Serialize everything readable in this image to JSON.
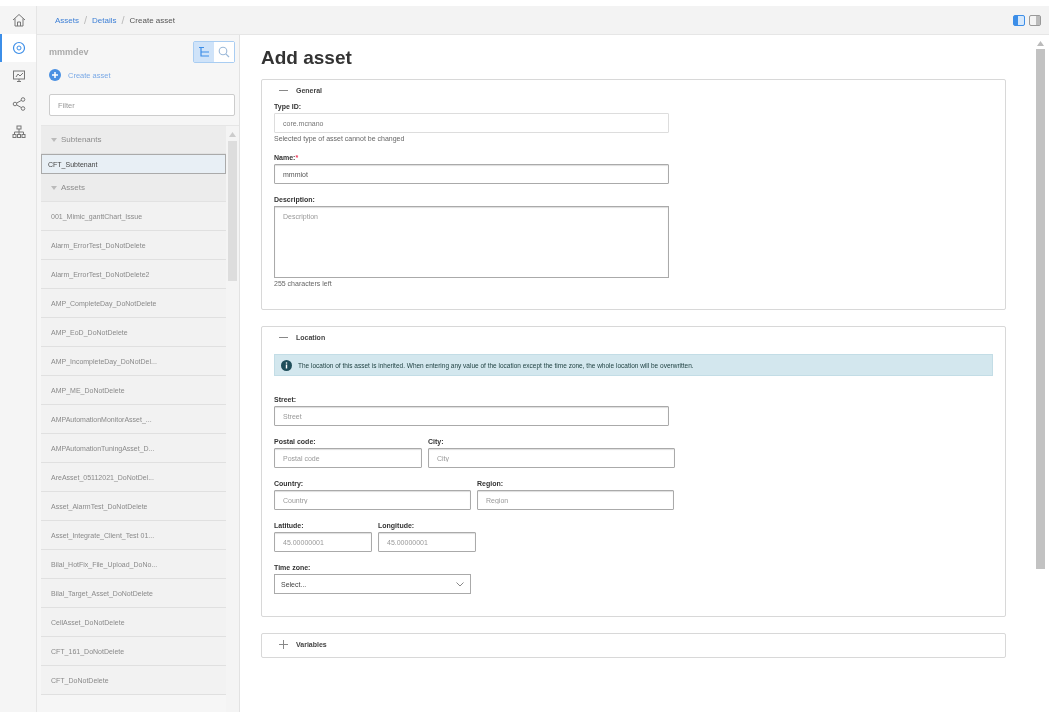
{
  "breadcrumbs": [
    {
      "label": "Assets",
      "kind": "link"
    },
    {
      "separator": "/",
      "label": "Details",
      "kind": "link"
    },
    {
      "separator": "/",
      "label": "Create asset",
      "kind": "current"
    }
  ],
  "view_toggles": [
    {
      "kind": "left-pane",
      "selected": true
    },
    {
      "kind": "right-pane",
      "selected": false
    }
  ],
  "rail": [
    {
      "kind": "home",
      "selected": false
    },
    {
      "kind": "assets",
      "selected": true
    },
    {
      "kind": "monitor",
      "selected": false
    },
    {
      "kind": "share",
      "selected": false
    },
    {
      "kind": "hierarchy",
      "selected": false
    }
  ],
  "sidebar": {
    "tenant": "mmmdev",
    "modes": [
      {
        "kind": "tree",
        "selected": true
      },
      {
        "kind": "search",
        "selected": false
      }
    ],
    "create_label": "Create asset",
    "filter_placeholder": "Filter",
    "tree": [
      {
        "label": "Subtenants",
        "expanded": true,
        "children": [
          {
            "label": "CFT_Subtenant",
            "selected": true
          }
        ]
      },
      {
        "label": "Assets",
        "expanded": true,
        "children": [
          {
            "label": "001_Mimic_ganttChart_Issue",
            "selected": false
          },
          {
            "label": "Alarm_ErrorTest_DoNotDelete",
            "selected": false
          },
          {
            "label": "Alarm_ErrorTest_DoNotDelete2",
            "selected": false
          },
          {
            "label": "AMP_CompleteDay_DoNotDelete",
            "selected": false
          },
          {
            "label": "AMP_EoD_DoNotDelete",
            "selected": false
          },
          {
            "label": "AMP_IncompleteDay_DoNotDel...",
            "selected": false
          },
          {
            "label": "AMP_ME_DoNotDelete",
            "selected": false
          },
          {
            "label": "AMPAutomationMonitorAsset_...",
            "selected": false
          },
          {
            "label": "AMPAutomationTuningAsset_D...",
            "selected": false
          },
          {
            "label": "AreAsset_05112021_DoNotDel...",
            "selected": false
          },
          {
            "label": "Asset_AlarmTest_DoNotDelete",
            "selected": false
          },
          {
            "label": "Asset_Integrate_Client_Test 01...",
            "selected": false
          },
          {
            "label": "Bilal_HotFix_File_Upload_DoNo...",
            "selected": false
          },
          {
            "label": "Bilal_Target_Asset_DoNotDelete",
            "selected": false
          },
          {
            "label": "CellAsset_DoNotDelete",
            "selected": false
          },
          {
            "label": "CFT_161_DoNotDelete",
            "selected": false
          },
          {
            "label": "CFT_DoNotDelete",
            "selected": false
          }
        ]
      }
    ]
  },
  "page_title": "Add asset",
  "sections": [
    {
      "title": "General",
      "expanded": true,
      "rows": [
        [
          {
            "label": "Type ID:",
            "kind": "text",
            "value": "core.mcnano",
            "readonly": true,
            "hint": "Selected type of asset cannot be changed"
          }
        ],
        [
          {
            "label": "Name:",
            "kind": "text",
            "value": "mmmiot",
            "required_mark": "*"
          }
        ],
        [
          {
            "label": "Description:",
            "kind": "textarea",
            "placeholder": "Description",
            "hint": "255 characters left"
          }
        ]
      ]
    },
    {
      "title": "Location",
      "expanded": true,
      "notice": "The location of this asset is inherited. When entering any value of the location except the time zone, the whole location will be overwritten.",
      "rows": [
        [
          {
            "label": "Street:",
            "kind": "text",
            "placeholder": "Street"
          }
        ],
        [
          {
            "label": "Postal code:",
            "kind": "text",
            "placeholder": "Postal code"
          },
          {
            "label": "City:",
            "kind": "text",
            "placeholder": "City"
          }
        ],
        [
          {
            "label": "Country:",
            "kind": "text",
            "placeholder": "Country"
          },
          {
            "label": "Region:",
            "kind": "text",
            "placeholder": "Region"
          }
        ],
        [
          {
            "label": "Latitude:",
            "kind": "text",
            "placeholder": "45.00000001"
          },
          {
            "label": "Longitude:",
            "kind": "text",
            "placeholder": "45.00000001"
          }
        ],
        [
          {
            "label": "Time zone:",
            "kind": "select",
            "value": "Select..."
          }
        ]
      ]
    },
    {
      "title": "Variables",
      "expanded": false
    }
  ]
}
